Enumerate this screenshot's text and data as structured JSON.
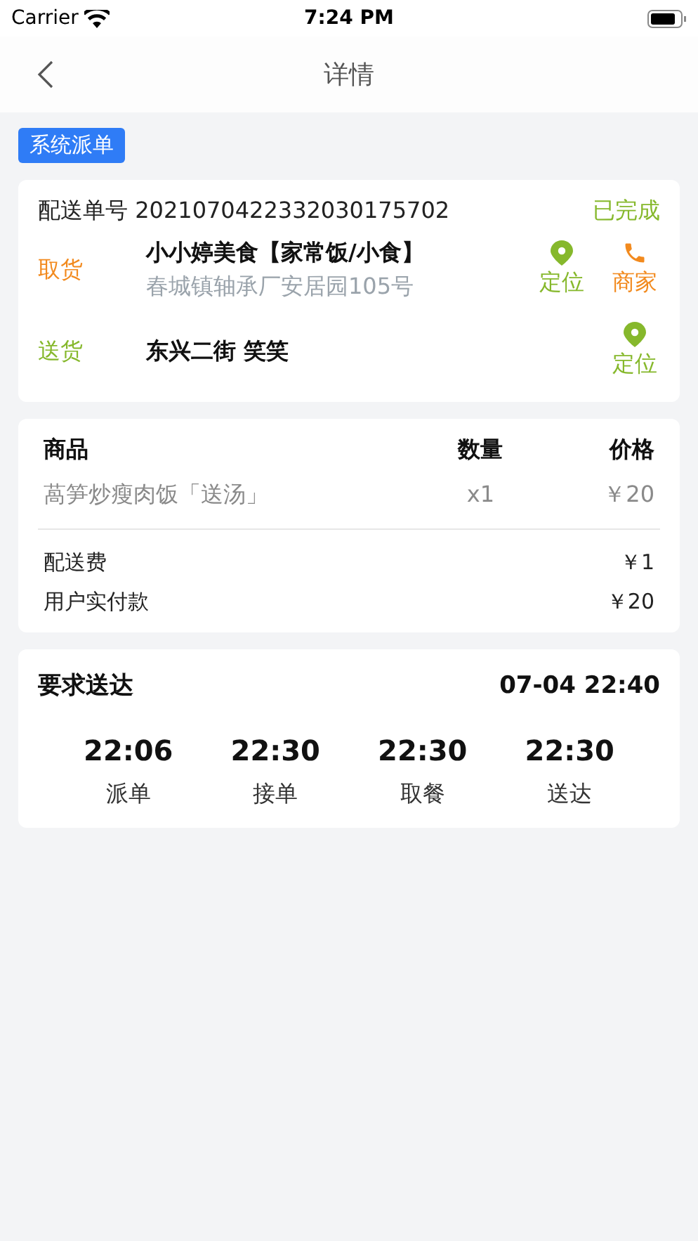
{
  "status_bar": {
    "carrier": "Carrier",
    "time": "7:24 PM"
  },
  "nav": {
    "title": "详情"
  },
  "tag": "系统派单",
  "order": {
    "label": "配送单号",
    "number": "2021070422332030175702",
    "status": "已完成",
    "stops": [
      {
        "kind": "pickup",
        "label": "取货",
        "name": "小小婷美食【家常饭/小食】",
        "address": "春城镇轴承厂安居园105号",
        "actions": [
          {
            "kind": "locate",
            "label": "定位"
          },
          {
            "kind": "call",
            "label": "商家"
          }
        ]
      },
      {
        "kind": "delivery",
        "label": "送货",
        "name": "东兴二街 笑笑",
        "actions": [
          {
            "kind": "locate",
            "label": "定位"
          }
        ]
      }
    ]
  },
  "goods": {
    "columns": [
      "商品",
      "数量",
      "价格"
    ],
    "rows": [
      [
        "萵笋炒瘦肉饭「送汤」",
        "x1",
        "￥20"
      ]
    ],
    "fees": [
      {
        "label": "配送费",
        "value": "￥1"
      },
      {
        "label": "用户实付款",
        "value": "￥20"
      }
    ]
  },
  "timeline": {
    "title": "要求送达",
    "deadline": "07-04 22:40",
    "steps": [
      {
        "time": "22:06",
        "label": "派单"
      },
      {
        "time": "22:30",
        "label": "接单"
      },
      {
        "time": "22:30",
        "label": "取餐"
      },
      {
        "time": "22:30",
        "label": "送达"
      }
    ]
  }
}
